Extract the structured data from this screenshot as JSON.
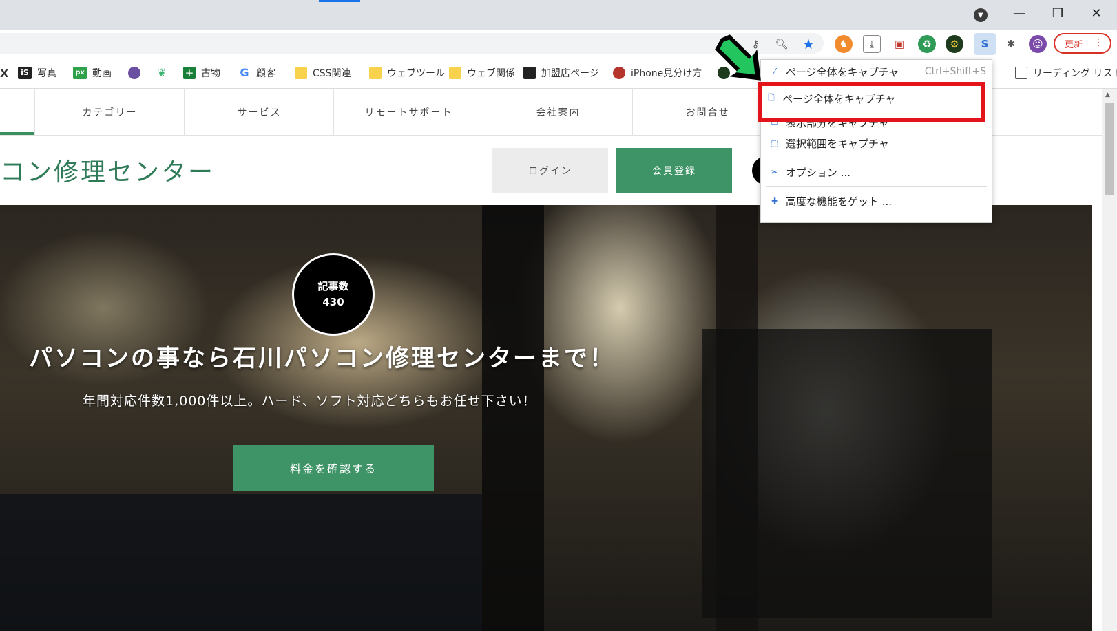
{
  "browser": {
    "window_controls": {
      "minimize": "—",
      "restore": "❐",
      "close": "✕"
    },
    "update_button": {
      "label": "更新",
      "more": "⋮"
    },
    "accent_color": "#1a73e8"
  },
  "bookmarks": [
    {
      "label": "写真"
    },
    {
      "label": "動画"
    },
    {
      "label": "古物"
    },
    {
      "label": "顧客"
    },
    {
      "label": "CSS関連"
    },
    {
      "label": "ウェブツール"
    },
    {
      "label": "ウェブ関係"
    },
    {
      "label": "加盟店ページ"
    },
    {
      "label": "iPhone見分け方"
    }
  ],
  "reading_list": "リーディング リスト",
  "nav": {
    "items": [
      "カテゴリー",
      "サービス",
      "リモートサポート",
      "会社案内",
      "お問合せ"
    ]
  },
  "site": {
    "title": "コン修理センター",
    "login": "ログイン",
    "register": "会員登録",
    "badge_label": "記事数",
    "badge_count": "430",
    "brand_color": "#3e9466"
  },
  "hero": {
    "title": "パソコンの事なら石川パソコン修理センターまで！",
    "subtitle": "年間対応件数1,000件以上。ハード、ソフト対応どちらもお任せ下さい！",
    "cta": "料金を確認する"
  },
  "menu": {
    "items": [
      {
        "icon": "⁄",
        "label": "ページ全体をキャプチャ",
        "shortcut": "Ctrl+Shift+S"
      },
      {
        "icon": "🗋",
        "label": "ページ全体をキャプチャ",
        "shortcut": ""
      },
      {
        "icon": "▭",
        "label": "表示部分をキャプチャ",
        "shortcut": ""
      },
      {
        "icon": "⬚",
        "label": "選択範囲をキャプチャ",
        "shortcut": ""
      },
      {
        "icon": "✂",
        "label": "オプション ...",
        "shortcut": ""
      },
      {
        "icon": "✚",
        "label": "高度な機能をゲット ...",
        "shortcut": ""
      }
    ],
    "highlight_color": "#e3151b"
  }
}
